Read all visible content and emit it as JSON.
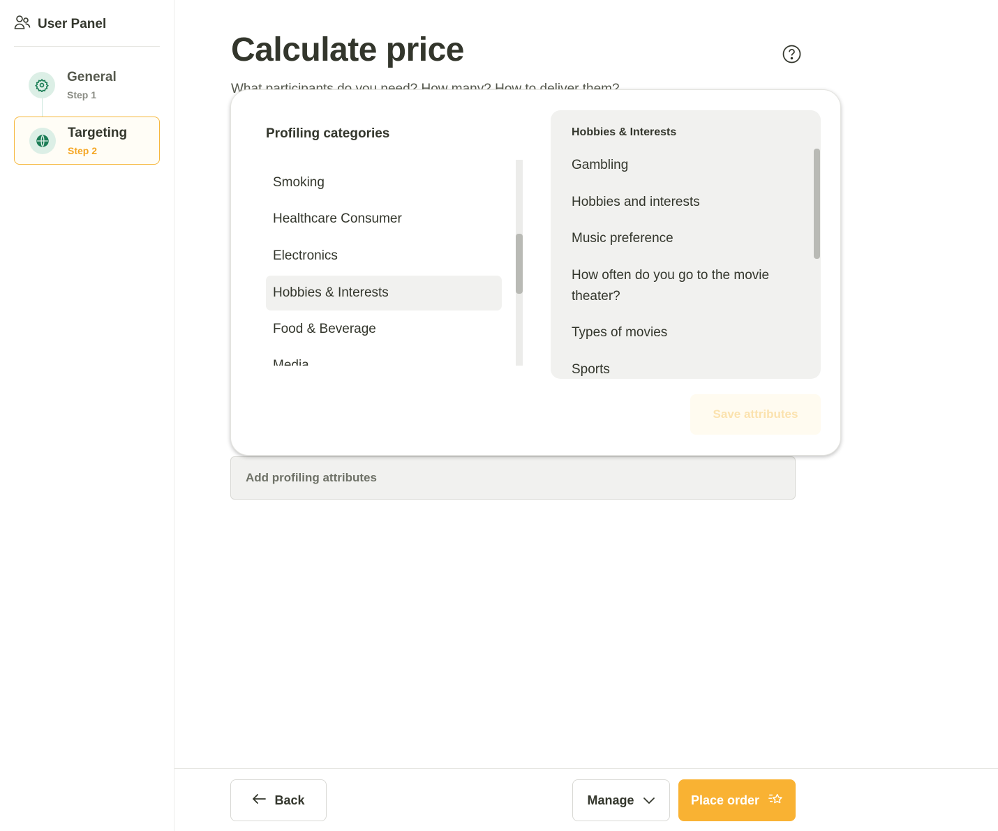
{
  "sidebar": {
    "brand": {
      "title": "User Panel",
      "icon": "users-icon"
    },
    "steps": [
      {
        "title": "General",
        "sub": "Step 1",
        "icon": "gear-icon",
        "state": "done"
      },
      {
        "title": "Targeting",
        "sub": "Step 2",
        "icon": "globe-icon",
        "state": "active"
      }
    ]
  },
  "main": {
    "title": "Calculate price",
    "subtitle": "What participants do you need? How many? How to deliver them?",
    "help_icon": "question-icon",
    "add_attributes_label": "Add profiling attributes"
  },
  "modal": {
    "categories_heading": "Profiling categories",
    "categories": [
      "Smoking",
      "Healthcare Consumer",
      "Electronics",
      "Hobbies & Interests",
      "Food & Beverage",
      "Media"
    ],
    "selected_category": "Hobbies & Interests",
    "attributes_heading": "Hobbies & Interests",
    "attributes": [
      "Gambling",
      "Hobbies and interests",
      "Music preference",
      "How often do you go to the movie theater?",
      "Types of movies",
      "Sports"
    ],
    "save_label": "Save attributes"
  },
  "footer": {
    "back_label": "Back",
    "manage_label": "Manage",
    "place_order_label": "Place order"
  },
  "colors": {
    "accent": "#f9b233",
    "brand_green": "#1b7d56",
    "text": "#33362c"
  }
}
